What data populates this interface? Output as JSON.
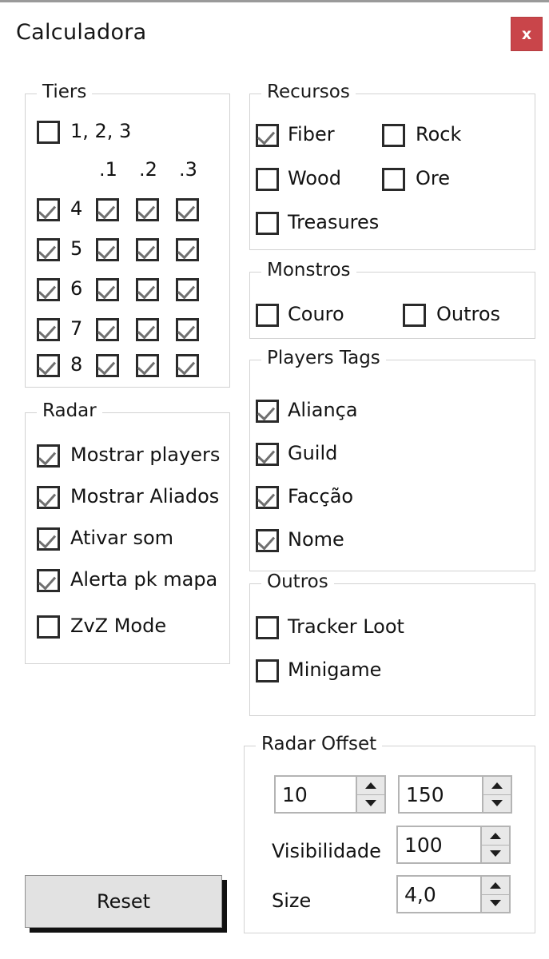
{
  "window": {
    "title": "Calculadora",
    "close_label": "x",
    "close_color": "#c9454a"
  },
  "tiers": {
    "legend": "Tiers",
    "master": {
      "label": "1, 2, 3",
      "checked": false
    },
    "column_headers": [
      ".1",
      ".2",
      ".3"
    ],
    "rows": [
      {
        "label": "4",
        "base_checked": true,
        "sub_checked": [
          true,
          true,
          true
        ]
      },
      {
        "label": "5",
        "base_checked": true,
        "sub_checked": [
          true,
          true,
          true
        ]
      },
      {
        "label": "6",
        "base_checked": true,
        "sub_checked": [
          true,
          true,
          true
        ]
      },
      {
        "label": "7",
        "base_checked": true,
        "sub_checked": [
          true,
          true,
          true
        ]
      },
      {
        "label": "8",
        "base_checked": true,
        "sub_checked": [
          true,
          true,
          true
        ]
      }
    ]
  },
  "radar": {
    "legend": "Radar",
    "items": [
      {
        "label": "Mostrar players",
        "checked": true
      },
      {
        "label": "Mostrar Aliados",
        "checked": true
      },
      {
        "label": "Ativar som",
        "checked": true
      },
      {
        "label": "Alerta pk mapa",
        "checked": true
      },
      {
        "label": "ZvZ Mode",
        "checked": false
      }
    ]
  },
  "recursos": {
    "legend": "Recursos",
    "items": [
      {
        "label": "Fiber",
        "checked": true
      },
      {
        "label": "Rock",
        "checked": false
      },
      {
        "label": "Wood",
        "checked": false
      },
      {
        "label": "Ore",
        "checked": false
      },
      {
        "label": "Treasures",
        "checked": false
      }
    ]
  },
  "monstros": {
    "legend": "Monstros",
    "items": [
      {
        "label": "Couro",
        "checked": false
      },
      {
        "label": "Outros",
        "checked": false
      }
    ]
  },
  "players_tags": {
    "legend": "Players Tags",
    "items": [
      {
        "label": "Aliança",
        "checked": true
      },
      {
        "label": "Guild",
        "checked": true
      },
      {
        "label": "Facção",
        "checked": true
      },
      {
        "label": "Nome",
        "checked": true
      }
    ]
  },
  "outros": {
    "legend": "Outros",
    "items": [
      {
        "label": "Tracker Loot",
        "checked": false
      },
      {
        "label": "Minigame",
        "checked": false
      }
    ]
  },
  "radar_offset": {
    "legend": "Radar Offset",
    "offset_x": "10",
    "offset_y": "150",
    "visibilidade_label": "Visibilidade",
    "visibilidade": "100",
    "size_label": "Size",
    "size": "4,0"
  },
  "reset": {
    "label": "Reset"
  }
}
